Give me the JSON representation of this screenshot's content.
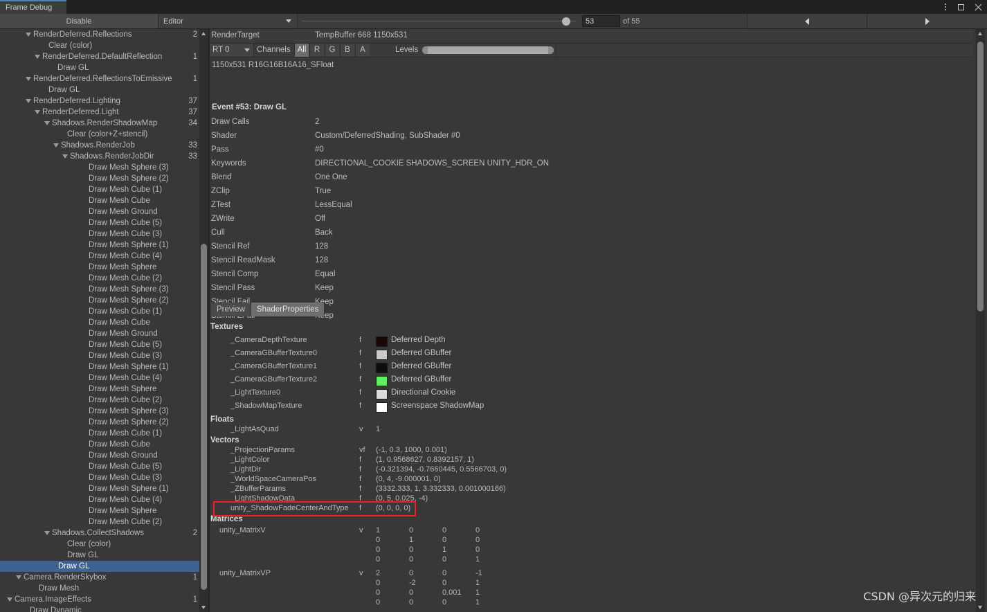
{
  "window": {
    "tab_title": "Frame Debug",
    "controls": {
      "menu": "kebab-menu-icon",
      "maximize": "maximize-icon",
      "close": "close-icon"
    }
  },
  "toolbar": {
    "disable_label": "Disable",
    "context_label": "Editor",
    "frame_value": "53",
    "frame_total": "of 55",
    "prev_label": "◀",
    "next_label": "▶"
  },
  "tree": {
    "rows": [
      {
        "label": "RenderDeferred.Reflections",
        "indent": 48,
        "fold": true,
        "count": "2",
        "selected": false
      },
      {
        "label": "Clear (color)",
        "indent": 70,
        "fold": false,
        "count": "",
        "selected": false
      },
      {
        "label": "RenderDeferred.DefaultReflection",
        "indent": 61,
        "fold": true,
        "count": "1",
        "selected": false
      },
      {
        "label": "Draw GL",
        "indent": 83,
        "fold": false,
        "count": "",
        "selected": false
      },
      {
        "label": "RenderDeferred.ReflectionsToEmissive",
        "indent": 48,
        "fold": true,
        "count": "1",
        "selected": false
      },
      {
        "label": "Draw GL",
        "indent": 70,
        "fold": false,
        "count": "",
        "selected": false
      },
      {
        "label": "RenderDeferred.Lighting",
        "indent": 48,
        "fold": true,
        "count": "37",
        "selected": false
      },
      {
        "label": "RenderDeferred.Light",
        "indent": 61,
        "fold": true,
        "count": "37",
        "selected": false
      },
      {
        "label": "Shadows.RenderShadowMap",
        "indent": 75,
        "fold": true,
        "count": "34",
        "selected": false
      },
      {
        "label": "Clear (color+Z+stencil)",
        "indent": 97,
        "fold": false,
        "count": "",
        "selected": false
      },
      {
        "label": "Shadows.RenderJob",
        "indent": 88,
        "fold": true,
        "count": "33",
        "selected": false
      },
      {
        "label": "Shadows.RenderJobDir",
        "indent": 101,
        "fold": true,
        "count": "33",
        "selected": false
      },
      {
        "label": "Draw Mesh Sphere (3)",
        "indent": 128,
        "fold": false,
        "count": "",
        "selected": false
      },
      {
        "label": "Draw Mesh Sphere (2)",
        "indent": 128,
        "fold": false,
        "count": "",
        "selected": false
      },
      {
        "label": "Draw Mesh Cube (1)",
        "indent": 128,
        "fold": false,
        "count": "",
        "selected": false
      },
      {
        "label": "Draw Mesh Cube",
        "indent": 128,
        "fold": false,
        "count": "",
        "selected": false
      },
      {
        "label": "Draw Mesh Ground",
        "indent": 128,
        "fold": false,
        "count": "",
        "selected": false
      },
      {
        "label": "Draw Mesh Cube (5)",
        "indent": 128,
        "fold": false,
        "count": "",
        "selected": false
      },
      {
        "label": "Draw Mesh Cube (3)",
        "indent": 128,
        "fold": false,
        "count": "",
        "selected": false
      },
      {
        "label": "Draw Mesh Sphere (1)",
        "indent": 128,
        "fold": false,
        "count": "",
        "selected": false
      },
      {
        "label": "Draw Mesh Cube (4)",
        "indent": 128,
        "fold": false,
        "count": "",
        "selected": false
      },
      {
        "label": "Draw Mesh Sphere",
        "indent": 128,
        "fold": false,
        "count": "",
        "selected": false
      },
      {
        "label": "Draw Mesh Cube (2)",
        "indent": 128,
        "fold": false,
        "count": "",
        "selected": false
      },
      {
        "label": "Draw Mesh Sphere (3)",
        "indent": 128,
        "fold": false,
        "count": "",
        "selected": false
      },
      {
        "label": "Draw Mesh Sphere (2)",
        "indent": 128,
        "fold": false,
        "count": "",
        "selected": false
      },
      {
        "label": "Draw Mesh Cube (1)",
        "indent": 128,
        "fold": false,
        "count": "",
        "selected": false
      },
      {
        "label": "Draw Mesh Cube",
        "indent": 128,
        "fold": false,
        "count": "",
        "selected": false
      },
      {
        "label": "Draw Mesh Ground",
        "indent": 128,
        "fold": false,
        "count": "",
        "selected": false
      },
      {
        "label": "Draw Mesh Cube (5)",
        "indent": 128,
        "fold": false,
        "count": "",
        "selected": false
      },
      {
        "label": "Draw Mesh Cube (3)",
        "indent": 128,
        "fold": false,
        "count": "",
        "selected": false
      },
      {
        "label": "Draw Mesh Sphere (1)",
        "indent": 128,
        "fold": false,
        "count": "",
        "selected": false
      },
      {
        "label": "Draw Mesh Cube (4)",
        "indent": 128,
        "fold": false,
        "count": "",
        "selected": false
      },
      {
        "label": "Draw Mesh Sphere",
        "indent": 128,
        "fold": false,
        "count": "",
        "selected": false
      },
      {
        "label": "Draw Mesh Cube (2)",
        "indent": 128,
        "fold": false,
        "count": "",
        "selected": false
      },
      {
        "label": "Draw Mesh Sphere (3)",
        "indent": 128,
        "fold": false,
        "count": "",
        "selected": false
      },
      {
        "label": "Draw Mesh Sphere (2)",
        "indent": 128,
        "fold": false,
        "count": "",
        "selected": false
      },
      {
        "label": "Draw Mesh Cube (1)",
        "indent": 128,
        "fold": false,
        "count": "",
        "selected": false
      },
      {
        "label": "Draw Mesh Cube",
        "indent": 128,
        "fold": false,
        "count": "",
        "selected": false
      },
      {
        "label": "Draw Mesh Ground",
        "indent": 128,
        "fold": false,
        "count": "",
        "selected": false
      },
      {
        "label": "Draw Mesh Cube (5)",
        "indent": 128,
        "fold": false,
        "count": "",
        "selected": false
      },
      {
        "label": "Draw Mesh Cube (3)",
        "indent": 128,
        "fold": false,
        "count": "",
        "selected": false
      },
      {
        "label": "Draw Mesh Sphere (1)",
        "indent": 128,
        "fold": false,
        "count": "",
        "selected": false
      },
      {
        "label": "Draw Mesh Cube (4)",
        "indent": 128,
        "fold": false,
        "count": "",
        "selected": false
      },
      {
        "label": "Draw Mesh Sphere",
        "indent": 128,
        "fold": false,
        "count": "",
        "selected": false
      },
      {
        "label": "Draw Mesh Cube (2)",
        "indent": 128,
        "fold": false,
        "count": "",
        "selected": false
      },
      {
        "label": "Shadows.CollectShadows",
        "indent": 75,
        "fold": true,
        "count": "2",
        "selected": false
      },
      {
        "label": "Clear (color)",
        "indent": 97,
        "fold": false,
        "count": "",
        "selected": false
      },
      {
        "label": "Draw GL",
        "indent": 97,
        "fold": false,
        "count": "",
        "selected": false
      },
      {
        "label": "Draw GL",
        "indent": 84,
        "fold": false,
        "count": "",
        "selected": true
      },
      {
        "label": "Camera.RenderSkybox",
        "indent": 34,
        "fold": true,
        "count": "1",
        "selected": false
      },
      {
        "label": "Draw Mesh",
        "indent": 56,
        "fold": false,
        "count": "",
        "selected": false
      },
      {
        "label": "Camera.ImageEffects",
        "indent": 21,
        "fold": true,
        "count": "1",
        "selected": false
      },
      {
        "label": "Draw Dynamic",
        "indent": 43,
        "fold": false,
        "count": "",
        "selected": false
      }
    ]
  },
  "detail": {
    "render_target_key": "RenderTarget",
    "render_target_value": "TempBuffer 668 1150x531",
    "rt_select": "RT 0",
    "channels_label": "Channels",
    "channel_buttons": [
      "All",
      "R",
      "G",
      "B",
      "A"
    ],
    "channel_active": "All",
    "levels_label": "Levels",
    "format": "1150x531 R16G16B16A16_SFloat",
    "event_title": "Event #53: Draw GL",
    "properties": [
      {
        "key": "Draw Calls",
        "value": "2"
      },
      {
        "key": "Shader",
        "value": "Custom/DeferredShading, SubShader #0"
      },
      {
        "key": "Pass",
        "value": "#0"
      },
      {
        "key": "Keywords",
        "value": "DIRECTIONAL_COOKIE SHADOWS_SCREEN UNITY_HDR_ON"
      },
      {
        "key": "Blend",
        "value": "One One"
      },
      {
        "key": "ZClip",
        "value": "True"
      },
      {
        "key": "ZTest",
        "value": "LessEqual"
      },
      {
        "key": "ZWrite",
        "value": "Off"
      },
      {
        "key": "Cull",
        "value": "Back"
      },
      {
        "key": "Stencil Ref",
        "value": "128"
      },
      {
        "key": "Stencil ReadMask",
        "value": "128"
      },
      {
        "key": "Stencil Comp",
        "value": "Equal"
      },
      {
        "key": "Stencil Pass",
        "value": "Keep"
      },
      {
        "key": "Stencil Fail",
        "value": "Keep"
      },
      {
        "key": "Stencil ZFail",
        "value": "Keep"
      }
    ],
    "tabs": [
      {
        "label": "Preview",
        "active": false
      },
      {
        "label": "ShaderProperties",
        "active": true
      }
    ],
    "sections": {
      "textures_title": "Textures",
      "floats_title": "Floats",
      "vectors_title": "Vectors",
      "matrices_title": "Matrices"
    },
    "textures": [
      {
        "name": "_CameraDepthTexture",
        "flag": "f",
        "swatch": "#1a0707",
        "label": "Deferred Depth"
      },
      {
        "name": "_CameraGBufferTexture0",
        "flag": "f",
        "swatch": "#c9c9c9",
        "label": "Deferred GBuffer"
      },
      {
        "name": "_CameraGBufferTexture1",
        "flag": "f",
        "swatch": "#0d0d0d",
        "label": "Deferred GBuffer"
      },
      {
        "name": "_CameraGBufferTexture2",
        "flag": "f",
        "swatch": "#5cf05c",
        "label": "Deferred GBuffer"
      },
      {
        "name": "_LightTexture0",
        "flag": "f",
        "swatch": "#dcdcdc",
        "label": "Directional Cookie"
      },
      {
        "name": "_ShadowMapTexture",
        "flag": "f",
        "swatch": "#ffffff",
        "label": "Screenspace ShadowMap"
      }
    ],
    "floats": [
      {
        "name": "_LightAsQuad",
        "flag": "v",
        "value": "1"
      }
    ],
    "vectors": [
      {
        "name": "_ProjectionParams",
        "flag": "vf",
        "value": "(-1, 0.3, 1000, 0.001)"
      },
      {
        "name": "_LightColor",
        "flag": "f",
        "value": "(1, 0.9568627, 0.8392157, 1)"
      },
      {
        "name": "_LightDir",
        "flag": "f",
        "value": "(-0.321394, -0.7660445, 0.5566703, 0)"
      },
      {
        "name": "_WorldSpaceCameraPos",
        "flag": "f",
        "value": "(0, 4, -9.000001, 0)"
      },
      {
        "name": "_ZBufferParams",
        "flag": "f",
        "value": "(3332.333, 1, 3.332333, 0.001000166)"
      },
      {
        "name": "_LightShadowData",
        "flag": "f",
        "value": "(0, 5, 0.025, -4)"
      },
      {
        "name": "unity_ShadowFadeCenterAndType",
        "flag": "f",
        "value": "(0, 0, 0, 0)",
        "highlighted": true
      }
    ],
    "matrices": [
      {
        "name": "unity_MatrixV",
        "flag": "v",
        "rows": [
          [
            "1",
            "0",
            "0",
            "0"
          ],
          [
            "0",
            "1",
            "0",
            "0"
          ],
          [
            "0",
            "0",
            "1",
            "0"
          ],
          [
            "0",
            "0",
            "0",
            "1"
          ]
        ]
      },
      {
        "name": "unity_MatrixVP",
        "flag": "v",
        "rows": [
          [
            "2",
            "0",
            "0",
            "-1"
          ],
          [
            "0",
            "-2",
            "0",
            "1"
          ],
          [
            "0",
            "0",
            "0.001",
            "1"
          ],
          [
            "0",
            "0",
            "0",
            "1"
          ]
        ]
      }
    ],
    "highlight_color": "#f02020"
  },
  "watermark": "CSDN @异次元的归来"
}
